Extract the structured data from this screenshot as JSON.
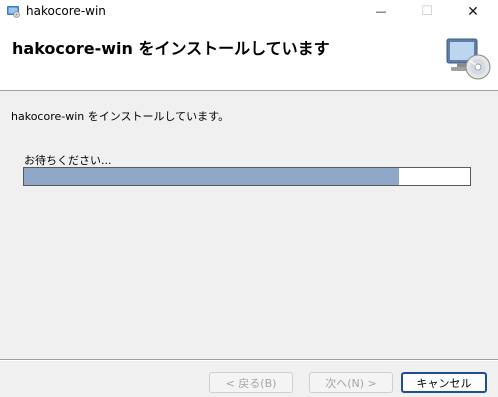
{
  "window": {
    "title": "hakocore-win",
    "controls": {
      "minimize": "—",
      "maximize": "☐",
      "close": "✕"
    }
  },
  "banner": {
    "title": "hakocore-win をインストールしています",
    "icon": "computer-cd-icon"
  },
  "main": {
    "status_text": "hakocore-win をインストールしています。",
    "wait_text": "お待ちください...",
    "progress_fraction": 0.84
  },
  "footer": {
    "back_label": "< 戻る(B)",
    "next_label": "次へ(N) >",
    "cancel_label": "キャンセル"
  },
  "colors": {
    "progress": "#8fa8c8",
    "accent_border": "#1f4f8f"
  }
}
